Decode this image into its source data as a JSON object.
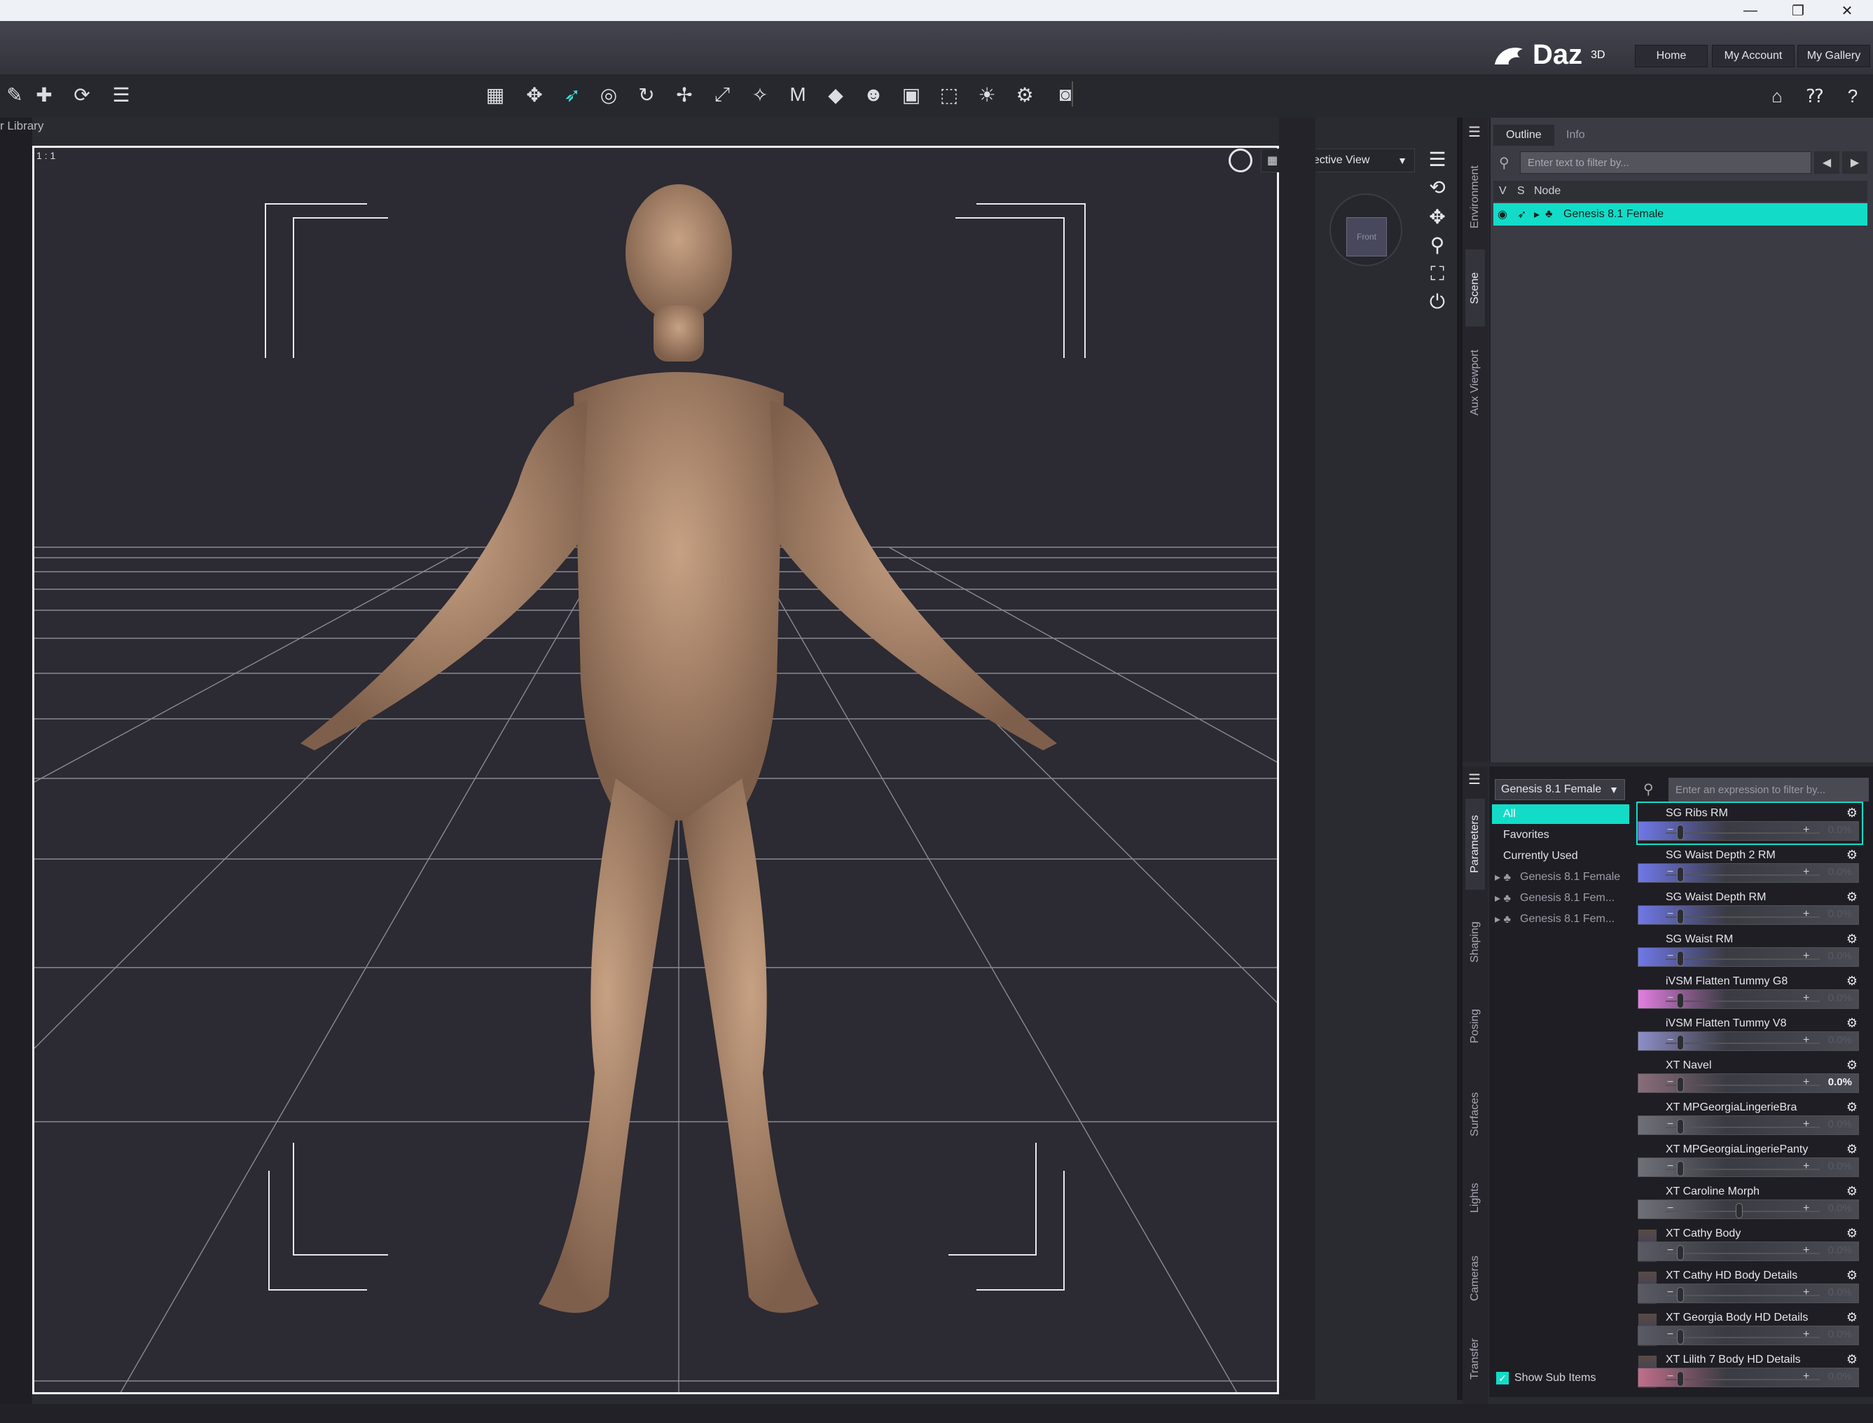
{
  "window": {
    "minimize": "—",
    "restore": "❐",
    "close": "✕"
  },
  "header": {
    "logo_text": "Daz",
    "logo_super": "3D",
    "buttons": [
      "Home",
      "My Account",
      "My Gallery"
    ]
  },
  "left_panel_label": "r Library",
  "viewport": {
    "corner_tag": "1 : 1",
    "view_select": "Perspective View",
    "cube_face": "Front"
  },
  "scene": {
    "tabs": [
      "Outline",
      "Info"
    ],
    "search_placeholder": "Enter text to filter by...",
    "columns": [
      "V",
      "S",
      "Node"
    ],
    "node": "Genesis 8.1 Female"
  },
  "side_tabs_top": [
    "Environment",
    "Scene",
    "Aux Viewport"
  ],
  "side_tabs_bottom": [
    "Parameters",
    "Shaping",
    "Posing",
    "Surfaces",
    "Lights",
    "Cameras",
    "Transfer"
  ],
  "params": {
    "figure": "Genesis 8.1 Female",
    "search_placeholder": "Enter an expression to filter by...",
    "groups": [
      "All",
      "Favorites",
      "Currently Used"
    ],
    "nodes": [
      "Genesis 8.1 Female",
      "Genesis 8.1 Fem...",
      "Genesis 8.1 Fem..."
    ],
    "show_sub_items": "Show Sub Items",
    "items": [
      {
        "label": "SG Ribs RM",
        "value": "0.0%",
        "color": "#6f78e8"
      },
      {
        "label": "SG Waist Depth 2 RM",
        "value": "0.0%",
        "color": "#6f78e8"
      },
      {
        "label": "SG Waist Depth RM",
        "value": "0.0%",
        "color": "#6f78e8"
      },
      {
        "label": "SG Waist RM",
        "value": "0.0%",
        "color": "#6f78e8"
      },
      {
        "label": "iVSM Flatten Tummy G8",
        "value": "0.0%",
        "color": "#e27ee0"
      },
      {
        "label": "iVSM Flatten Tummy V8",
        "value": "0.0%",
        "color": "#8e8ec8"
      },
      {
        "label": "XT Navel",
        "value": "0.0%",
        "color": "#8a6e7a"
      },
      {
        "label": "XT MPGeorgiaLingerieBra",
        "value": "0.0%",
        "color": "#707078"
      },
      {
        "label": "XT MPGeorgiaLingeriePanty",
        "value": "0.0%",
        "color": "#707078"
      },
      {
        "label": "XT Caroline Morph",
        "value": "0.0%",
        "color": "#707078"
      },
      {
        "label": "XT Cathy Body",
        "value": "0.0%",
        "color": "#5a5a64"
      },
      {
        "label": "XT Cathy HD Body Details",
        "value": "0.0%",
        "color": "#5a5a64"
      },
      {
        "label": "XT Georgia Body HD Details",
        "value": "0.0%",
        "color": "#5a5a64"
      },
      {
        "label": "XT Lilith 7 Body HD Details",
        "value": "0.0%",
        "color": "#c06f8a"
      }
    ]
  }
}
